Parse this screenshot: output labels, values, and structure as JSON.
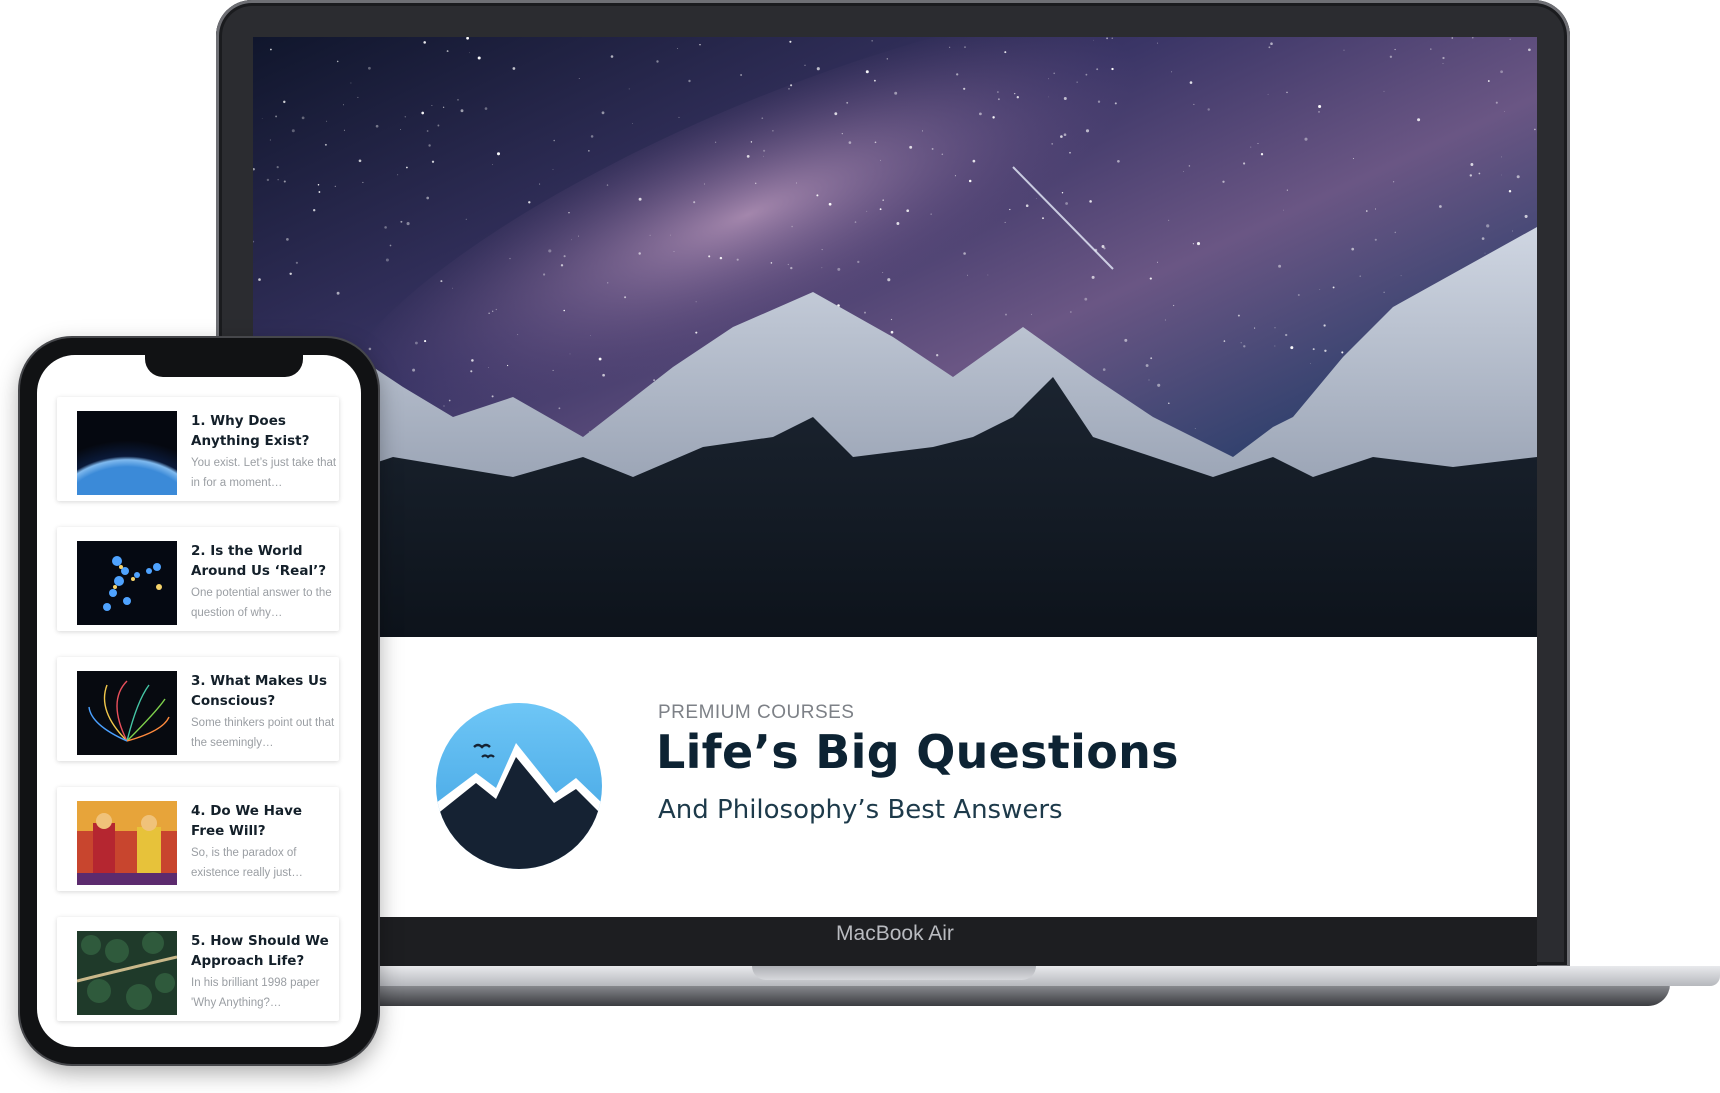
{
  "laptop": {
    "brand": "MacBook Air"
  },
  "course": {
    "eyebrow": "PREMIUM COURSES",
    "title": "Life’s Big Questions",
    "subtitle": "And Philosophy’s Best Answers",
    "logo_icon": "mountain-circle-icon",
    "colors": {
      "title": "#0d2333",
      "logo_sky": "#5bb8ef",
      "logo_mountain": "#152233"
    }
  },
  "lessons": [
    {
      "title": "1. Why Does Anything Exist?",
      "excerpt": "You exist. Let’s just take that in for a moment…",
      "thumb_icon": "earth-from-space-image"
    },
    {
      "title": "2. Is the World Around Us ‘Real’?",
      "excerpt": "One potential answer to the question of why…",
      "thumb_icon": "glowing-figure-image"
    },
    {
      "title": "3. What Makes Us Conscious?",
      "excerpt": "Some thinkers point out that the seemingly…",
      "thumb_icon": "neural-brain-image"
    },
    {
      "title": "4. Do We Have Free Will?",
      "excerpt": "So, is the paradox of existence really just…",
      "thumb_icon": "puppets-image"
    },
    {
      "title": "5. How Should We Approach Life?",
      "excerpt": "In his brilliant 1998 paper 'Why Anything?…",
      "thumb_icon": "forest-road-image"
    }
  ]
}
